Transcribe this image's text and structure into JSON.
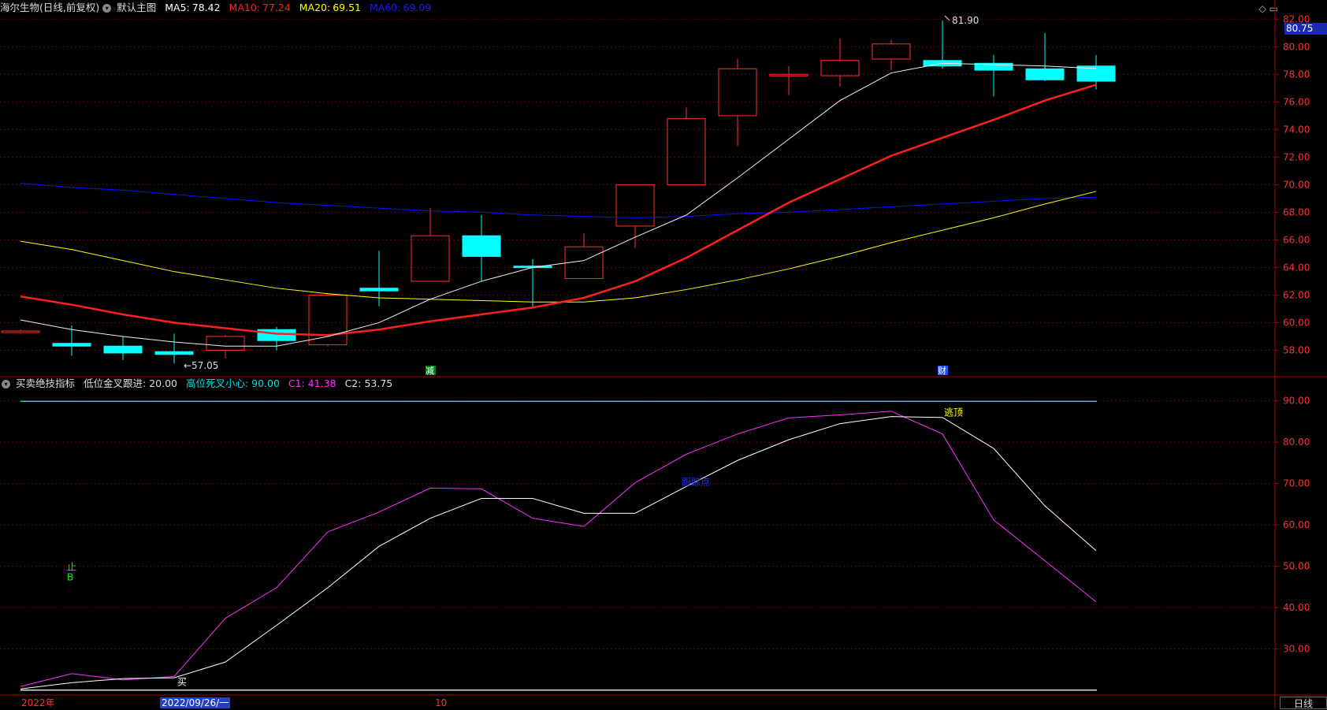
{
  "header": {
    "stock_name": "海尔生物(日线,前复权)",
    "view_name": "默认主图",
    "ma5": {
      "label": "MA5:",
      "value": "78.42",
      "color": "#ffffff"
    },
    "ma10": {
      "label": "MA10:",
      "value": "77.24",
      "color": "#ff2020"
    },
    "ma20": {
      "label": "MA20:",
      "value": "69.51",
      "color": "#ffff00"
    },
    "ma60": {
      "label": "MA60:",
      "value": "69.09",
      "color": "#1010ff"
    }
  },
  "indicator_header": {
    "name": "买卖绝技指标",
    "low_label": "低位金叉跟进: 20.00",
    "high_label": "高位死叉小心: 90.00",
    "c1_label": "C1: 41.38",
    "c2_label": "C2: 53.75"
  },
  "top_right_icons": "◇ ▭",
  "current_price": "80.75",
  "x_axis": {
    "year_label": "2022年",
    "date_box": "2022/09/26/一",
    "month_label": "10"
  },
  "period_button": "日线",
  "colors": {
    "up": "#ff3030",
    "down": "#00ffff",
    "grid": "#6b0000",
    "axis": "#a00000",
    "axis_text": "#ff3030"
  },
  "chart_data": [
    {
      "type": "candlestick",
      "y_ticks": [
        "82.00",
        "80.00",
        "78.00",
        "76.00",
        "74.00",
        "72.00",
        "70.00",
        "68.00",
        "66.00",
        "64.00",
        "62.00",
        "60.00",
        "58.00"
      ],
      "ylim": [
        56.2,
        82.7
      ],
      "candles": [
        {
          "open": 59.3,
          "close": 59.4,
          "high": 59.5,
          "low": 59.2
        },
        {
          "open": 58.5,
          "close": 58.3,
          "high": 59.8,
          "low": 57.6
        },
        {
          "open": 58.3,
          "close": 57.8,
          "high": 59.0,
          "low": 57.3
        },
        {
          "open": 57.9,
          "close": 57.7,
          "high": 59.2,
          "low": 57.05
        },
        {
          "open": 58.0,
          "close": 59.0,
          "high": 59.1,
          "low": 57.4
        },
        {
          "open": 59.5,
          "close": 58.7,
          "high": 59.7,
          "low": 58.0
        },
        {
          "open": 58.4,
          "close": 62.0,
          "high": 62.1,
          "low": 58.3
        },
        {
          "open": 62.5,
          "close": 62.3,
          "high": 65.2,
          "low": 61.2
        },
        {
          "open": 63.0,
          "close": 66.3,
          "high": 68.3,
          "low": 63.0
        },
        {
          "open": 66.3,
          "close": 64.8,
          "high": 67.8,
          "low": 63.0
        },
        {
          "open": 64.1,
          "close": 64.0,
          "high": 64.6,
          "low": 61.1
        },
        {
          "open": 63.2,
          "close": 65.5,
          "high": 66.5,
          "low": 63.2
        },
        {
          "open": 67.0,
          "close": 70.0,
          "high": 70.0,
          "low": 65.4
        },
        {
          "open": 70.0,
          "close": 74.8,
          "high": 75.6,
          "low": 70.0
        },
        {
          "open": 75.0,
          "close": 78.4,
          "high": 79.1,
          "low": 72.8
        },
        {
          "open": 77.9,
          "close": 78.0,
          "high": 78.6,
          "low": 76.5
        },
        {
          "open": 77.9,
          "close": 79.0,
          "high": 80.6,
          "low": 77.1
        },
        {
          "open": 79.1,
          "close": 80.2,
          "high": 80.5,
          "low": 78.3
        },
        {
          "open": 79.0,
          "close": 78.6,
          "high": 81.9,
          "low": 78.4
        },
        {
          "open": 78.8,
          "close": 78.3,
          "high": 79.4,
          "low": 76.4
        },
        {
          "open": 78.4,
          "close": 77.6,
          "high": 81.0,
          "low": 77.5
        },
        {
          "open": 78.6,
          "close": 77.5,
          "high": 79.4,
          "low": 76.9
        }
      ],
      "ma5": [
        60.2,
        59.5,
        59.0,
        58.6,
        58.3,
        58.3,
        59.0,
        60.0,
        61.7,
        63.0,
        64.0,
        64.5,
        66.2,
        67.8,
        70.5,
        73.3,
        76.1,
        78.1,
        78.8,
        78.7,
        78.6,
        78.42
      ],
      "ma10": [
        61.9,
        61.3,
        60.6,
        60.0,
        59.6,
        59.2,
        59.1,
        59.5,
        60.1,
        60.6,
        61.1,
        61.8,
        63.0,
        64.7,
        66.7,
        68.7,
        70.4,
        72.1,
        73.4,
        74.7,
        76.1,
        77.24
      ],
      "ma20": [
        65.9,
        65.3,
        64.5,
        63.7,
        63.1,
        62.5,
        62.1,
        61.8,
        61.7,
        61.6,
        61.5,
        61.5,
        61.8,
        62.4,
        63.1,
        63.9,
        64.8,
        65.8,
        66.7,
        67.6,
        68.6,
        69.51
      ],
      "ma60": [
        70.1,
        69.8,
        69.6,
        69.3,
        69.0,
        68.7,
        68.5,
        68.3,
        68.1,
        68.0,
        67.8,
        67.7,
        67.6,
        67.7,
        67.9,
        68.0,
        68.2,
        68.4,
        68.6,
        68.8,
        69.0,
        69.09
      ],
      "annotations": [
        {
          "text": "57.05",
          "candle": 3,
          "value": 57.05
        },
        {
          "text": "81.90",
          "candle": 18,
          "value": 81.9
        },
        {
          "text": "减",
          "candle": 8,
          "color": "#ffffff",
          "bg": "#0a7a20"
        },
        {
          "text": "财",
          "candle": 18,
          "color": "#ffffff",
          "bg": "#1e50ff"
        }
      ]
    },
    {
      "type": "line",
      "y_ticks": [
        "90.00",
        "80.00",
        "70.00",
        "60.00",
        "50.00",
        "40.00",
        "30.00"
      ],
      "ylim": [
        19.2,
        93.0
      ],
      "series": [
        {
          "name": "C1",
          "color": "#ff30ff",
          "values": [
            20.9,
            24.0,
            22.5,
            23.3,
            37.4,
            44.8,
            58.3,
            63.1,
            68.9,
            68.7,
            61.6,
            59.6,
            70.2,
            77.1,
            82.0,
            85.9,
            86.6,
            87.5,
            82.0,
            61.2,
            51.3,
            41.38
          ]
        },
        {
          "name": "C2",
          "color": "#ffffff",
          "values": [
            20.3,
            21.8,
            22.8,
            23.0,
            26.8,
            35.7,
            44.8,
            54.8,
            61.6,
            66.4,
            66.4,
            62.8,
            62.8,
            69.3,
            75.6,
            80.6,
            84.5,
            86.2,
            86.0,
            78.5,
            64.6,
            53.75
          ]
        }
      ],
      "reference_lines": [
        {
          "value": 89.9,
          "color": "#00d0d0"
        },
        {
          "value": 20.0,
          "color": "#dddddd"
        }
      ],
      "annotations": [
        {
          "text": "逃顶",
          "candle": 18,
          "value": 86.4,
          "color": "#ffff00"
        },
        {
          "text": "B",
          "candle": 1,
          "value": 46.6,
          "color": "#00ff00"
        },
        {
          "text": "止",
          "candle": 1,
          "value": 49.0,
          "color": "#00ff00"
        },
        {
          "text": "买",
          "candle": 3,
          "value": 21.2,
          "color": "#ffffff"
        },
        {
          "text": "跟踪点",
          "candle": 13,
          "value": 69.5,
          "color": "#1e30ff"
        }
      ]
    }
  ]
}
